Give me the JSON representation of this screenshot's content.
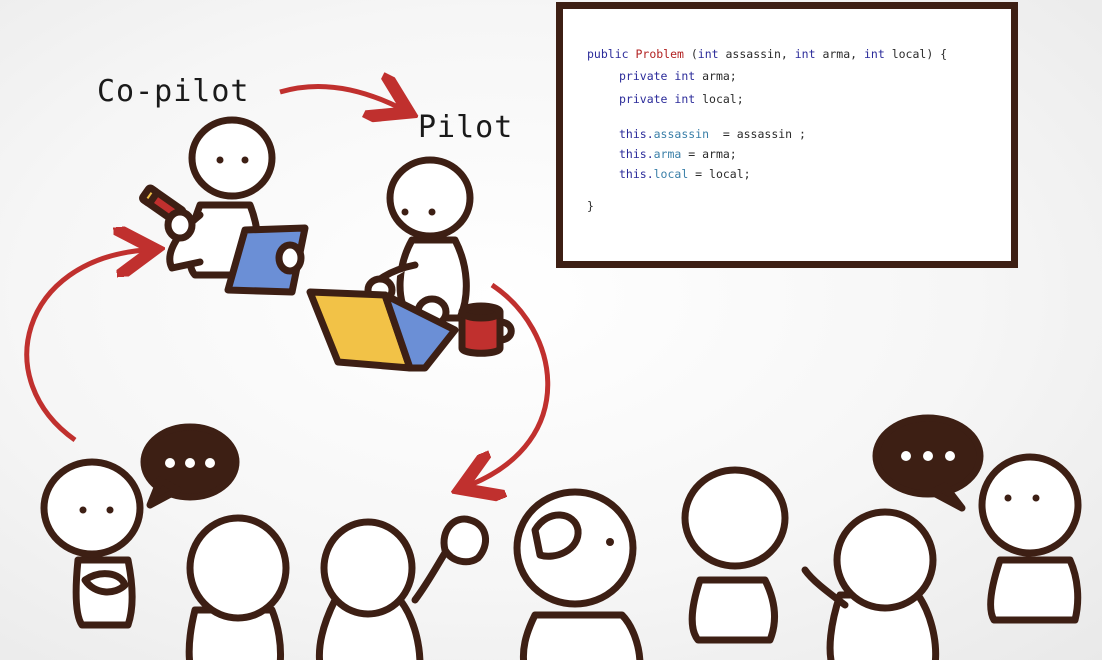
{
  "labels": {
    "copilot": "Co-pilot",
    "pilot": "Pilot"
  },
  "code": {
    "lines": [
      {
        "indent": 0,
        "parts": [
          {
            "t": "public ",
            "c": "kw"
          },
          {
            "t": "Problem",
            "c": "cls"
          },
          {
            "t": " (",
            "c": ""
          },
          {
            "t": "int",
            "c": "kw"
          },
          {
            "t": " assassin, ",
            "c": ""
          },
          {
            "t": "int",
            "c": "kw"
          },
          {
            "t": " arma, ",
            "c": ""
          },
          {
            "t": "int",
            "c": "kw"
          },
          {
            "t": " local) {",
            "c": ""
          }
        ]
      },
      {
        "indent": 1,
        "parts": [
          {
            "t": "private ",
            "c": "kw"
          },
          {
            "t": "int",
            "c": "kw"
          },
          {
            "t": " arma;",
            "c": ""
          }
        ]
      },
      {
        "indent": 1,
        "parts": [
          {
            "t": "private ",
            "c": "kw"
          },
          {
            "t": "int",
            "c": "kw"
          },
          {
            "t": " local;",
            "c": ""
          }
        ]
      },
      {
        "indent": 1,
        "parts": [
          {
            "t": "this.",
            "c": "kw"
          },
          {
            "t": "assassin",
            "c": "fld"
          },
          {
            "t": "  = assassin ;",
            "c": ""
          }
        ]
      },
      {
        "indent": 1,
        "parts": [
          {
            "t": "this.",
            "c": "kw"
          },
          {
            "t": "arma",
            "c": "fld"
          },
          {
            "t": " = arma;",
            "c": ""
          }
        ]
      },
      {
        "indent": 1,
        "parts": [
          {
            "t": "this.",
            "c": "kw"
          },
          {
            "t": "local",
            "c": "fld"
          },
          {
            "t": " = local;",
            "c": ""
          }
        ]
      },
      {
        "indent": 0,
        "parts": [
          {
            "t": "}",
            "c": ""
          }
        ]
      }
    ]
  },
  "icons": {
    "speech_bubble_left": "speech-bubble-ellipsis-icon",
    "speech_bubble_right": "speech-bubble-ellipsis-icon"
  },
  "colors": {
    "outline": "#3d1f14",
    "arrow": "#c0302e",
    "tablet": "#6b8fd6",
    "laptop_screen": "#6b8fd6",
    "laptop_lid": "#f2c247",
    "mug": "#c0302e",
    "pencil": "#c0302e"
  }
}
